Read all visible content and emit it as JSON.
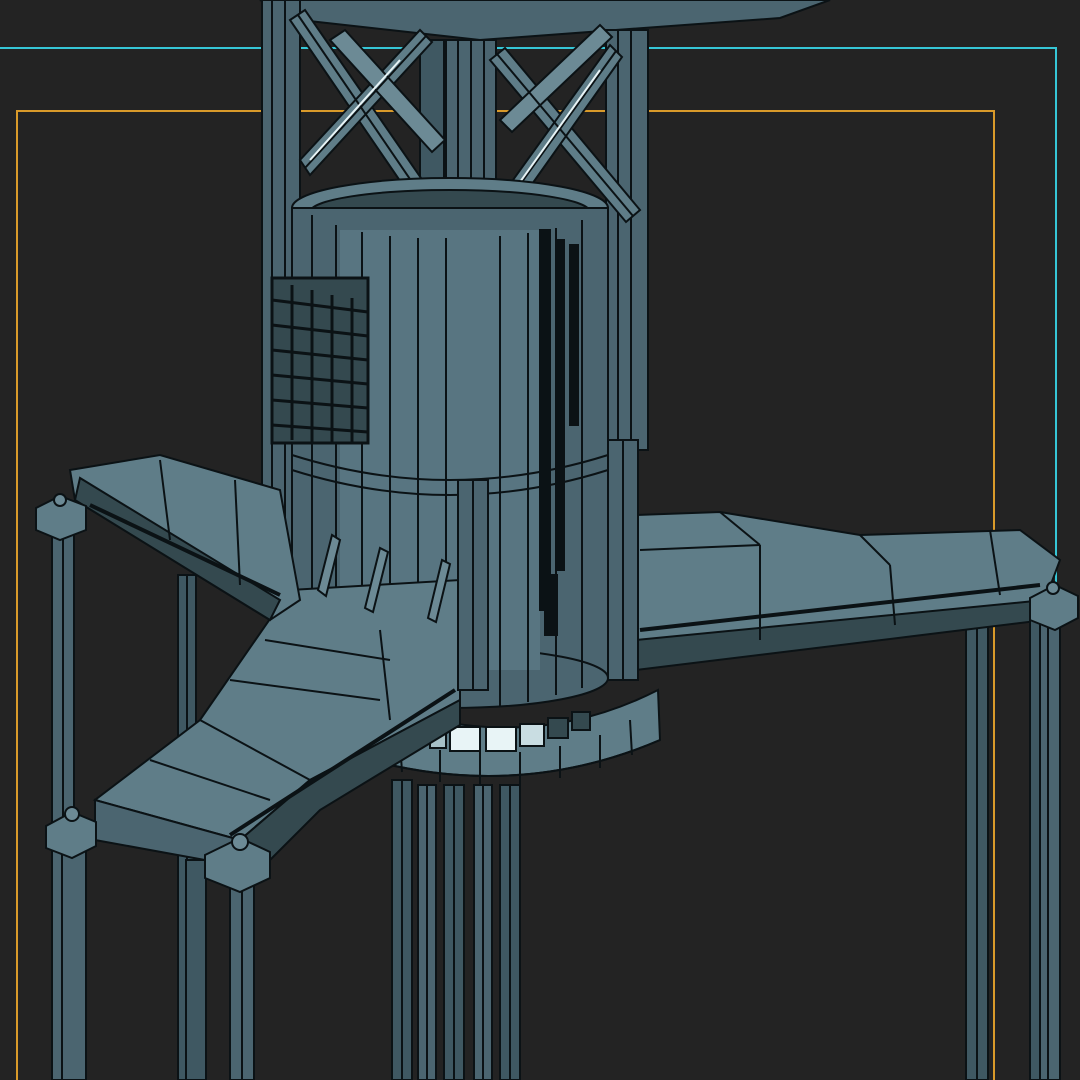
{
  "viewport": {
    "background": "#232323",
    "safe_frame_outer_color": "#36c6d6",
    "safe_frame_inner_color": "#d99a2a",
    "mesh_fill": "#4b6570",
    "mesh_fill_light": "#5f7d88",
    "mesh_fill_dark": "#34494f",
    "wire_color": "#0b1215",
    "highlight": "#e8f4f6"
  }
}
